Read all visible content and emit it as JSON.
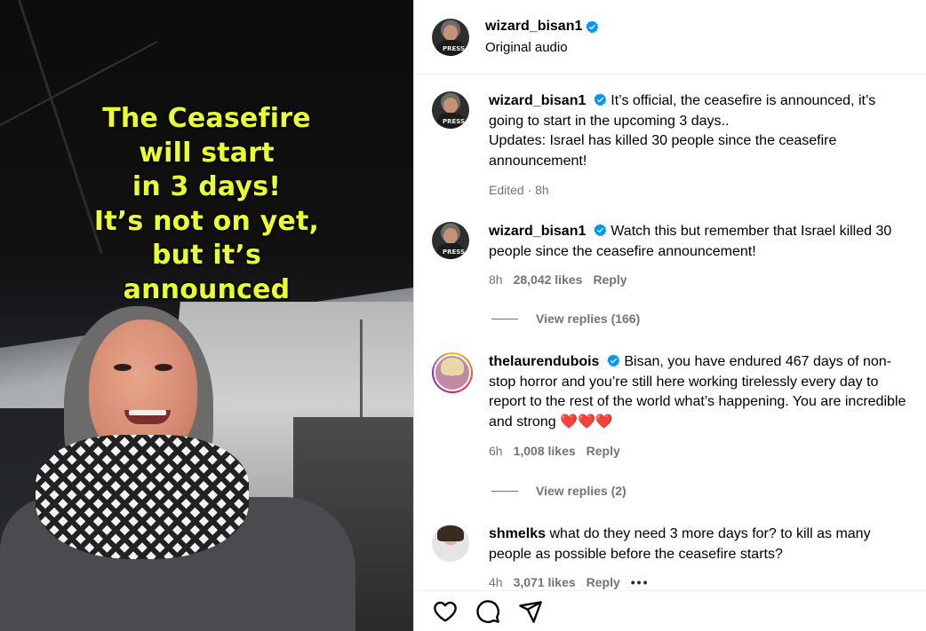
{
  "video": {
    "overlay_lines": [
      "The Ceasefire",
      "will start",
      "in 3 days!",
      "It’s not on yet,",
      "but it’s",
      "announced"
    ],
    "overlay_color": "#eaff2f",
    "vest_label": "PRESS"
  },
  "header": {
    "username": "wizard_bisan1",
    "subtitle": "Original audio",
    "verified": true
  },
  "comments": [
    {
      "username": "wizard_bisan1",
      "verified": true,
      "text": "It’s official, the ceasefire is announced, it’s going to start in the upcoming 3 days.. Updates: Israel has killed 30 people since the ceasefire announcement!",
      "line1": "It’s official, the ceasefire is announced, it’s",
      "line2": "going to start in the upcoming 3 days..",
      "line3": "Updates: Israel has killed 30 people since the ceasefire",
      "line4": "announcement!",
      "meta": "Edited · 8h"
    },
    {
      "username": "wizard_bisan1",
      "verified": true,
      "text": "Watch this but remember that Israel killed 30 people since the ceasefire announcement!",
      "time": "8h",
      "likes": "28,042 likes",
      "reply": "Reply",
      "view_replies": "View replies (166)"
    },
    {
      "username": "thelaurendubois",
      "verified": true,
      "text": "Bisan, you have endured 467 days of non-stop horror and you’re still here working tirelessly every day to report to the rest of the world what’s happening. You are incredible and strong",
      "hearts": "❤️❤️❤️",
      "time": "6h",
      "likes": "1,008 likes",
      "reply": "Reply",
      "view_replies": "View replies (2)"
    },
    {
      "username": "shmelks",
      "verified": false,
      "text": "what do they need 3 more days for? to kill as many people as possible before the ceasefire starts?",
      "time": "4h",
      "likes": "3,071 likes",
      "reply": "Reply",
      "more": "•••"
    }
  ],
  "footer": {
    "icons": [
      "heart-icon",
      "comment-icon",
      "share-icon"
    ]
  },
  "colors": {
    "verified_blue": "#0095f6",
    "muted_text": "#737373",
    "heart_red": "#e0245e"
  }
}
